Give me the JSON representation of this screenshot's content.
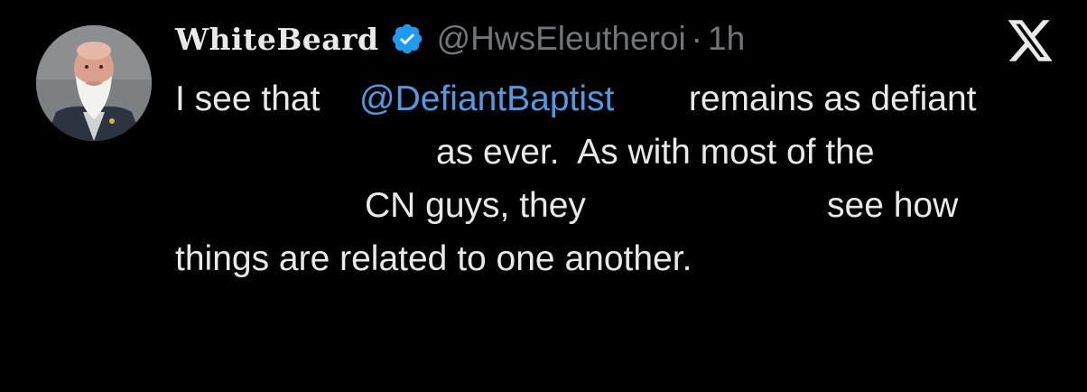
{
  "author": {
    "display_name": "WhiteBeard",
    "handle": "@HwsEleutheroi",
    "separator": "·",
    "time": "1h",
    "avatar_icon": "bearded-man-avatar",
    "verified_icon": "verified-badge-icon",
    "verified_color": "#1d9bf0"
  },
  "platform": {
    "logo_icon": "x-logo-icon"
  },
  "tweet": {
    "line1_prefix": "I see that ",
    "mention": "@DefiantBaptist",
    "line1_suffix": " remains as defiant",
    "line2": "as ever.  As with most of the",
    "line3_a": "CN guys, they",
    "line3_b": "see how",
    "line4": "things are related to one another."
  },
  "colors": {
    "background": "#000000",
    "text": "#e7e9ea",
    "muted": "#71767b",
    "link": "#4d9ce8"
  }
}
